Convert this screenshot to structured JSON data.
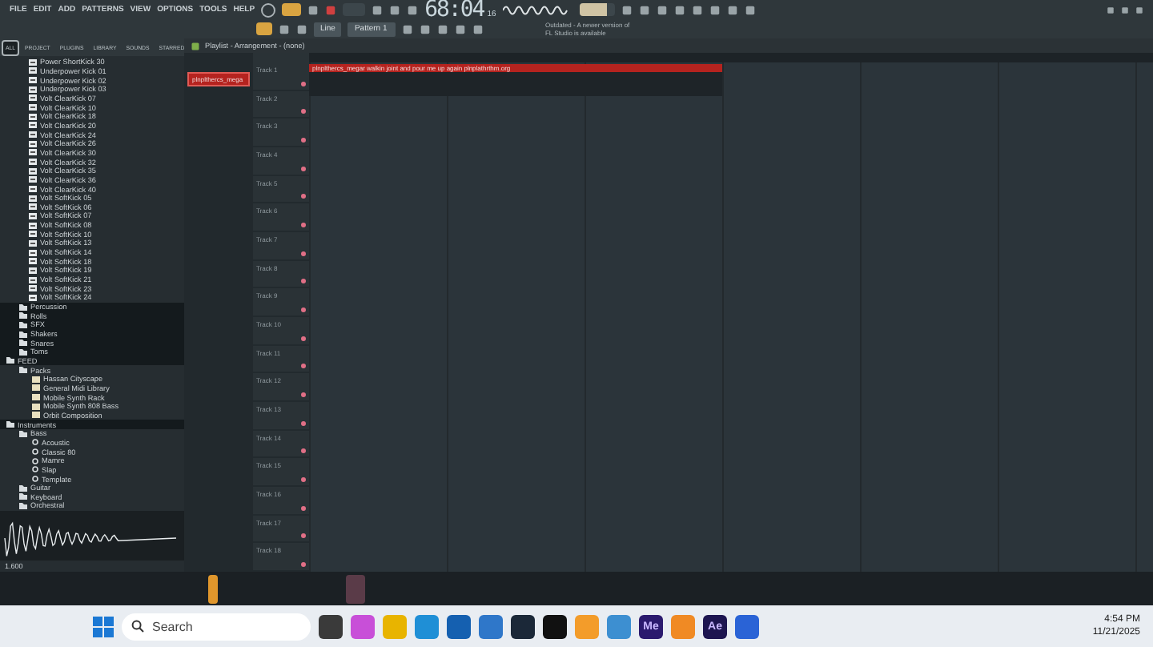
{
  "menu": [
    "FILE",
    "EDIT",
    "ADD",
    "PATTERNS",
    "VIEW",
    "OPTIONS",
    "TOOLS",
    "HELP"
  ],
  "song_time": {
    "main": "68:04",
    "sub": "16"
  },
  "pattern_mode": {
    "on": true
  },
  "master_volume": {
    "level": 0.8
  },
  "pattern": "Pattern 1",
  "snap": "Line",
  "update_hint": [
    "Outdated - A newer version of",
    "FL Studio is available"
  ],
  "browser": {
    "tabs": [
      {
        "label": "ALL",
        "selected": true
      },
      {
        "label": "PROJECT",
        "selected": false
      },
      {
        "label": "PLUGINS",
        "selected": false
      },
      {
        "label": "LIBRARY",
        "selected": false
      },
      {
        "label": "SOUNDS",
        "selected": false
      },
      {
        "label": "STARRED",
        "selected": false
      }
    ],
    "files": [
      "Power ShortKick 30",
      "Underpower Kick 01",
      "Underpower Kick 02",
      "Underpower Kick 03",
      "Volt ClearKick 07",
      "Volt ClearKick 10",
      "Volt ClearKick 18",
      "Volt ClearKick 20",
      "Volt ClearKick 24",
      "Volt ClearKick 26",
      "Volt ClearKick 30",
      "Volt ClearKick 32",
      "Volt ClearKick 35",
      "Volt ClearKick 36",
      "Volt ClearKick 40",
      "Volt SoftKick 05",
      "Volt SoftKick 06",
      "Volt SoftKick 07",
      "Volt SoftKick 08",
      "Volt SoftKick 10",
      "Volt SoftKick 13",
      "Volt SoftKick 14",
      "Volt SoftKick 18",
      "Volt SoftKick 19",
      "Volt SoftKick 21",
      "Volt SoftKick 23",
      "Volt SoftKick 24"
    ],
    "folders": [
      "Percussion",
      "Rolls",
      "SFX",
      "Shakers",
      "Snares",
      "Toms"
    ],
    "tree": [
      {
        "label": "FEED",
        "kind": "folder",
        "children": [
          {
            "label": "Packs",
            "kind": "folder",
            "children": [
              {
                "label": "Hassan Cityscape",
                "kind": "pack"
              },
              {
                "label": "General Midi Library",
                "kind": "pack"
              },
              {
                "label": "Mobile Synth Rack",
                "kind": "pack"
              },
              {
                "label": "Mobile Synth 808 Bass",
                "kind": "pack"
              },
              {
                "label": "Orbit Composition",
                "kind": "pack"
              }
            ]
          }
        ]
      },
      {
        "label": "Instruments",
        "kind": "folder",
        "children": [
          {
            "label": "Bass",
            "kind": "folder",
            "children": [
              {
                "label": "Acoustic",
                "kind": "preset"
              },
              {
                "label": "Classic 80",
                "kind": "preset"
              },
              {
                "label": "Mamre",
                "kind": "preset"
              },
              {
                "label": "Slap",
                "kind": "preset"
              },
              {
                "label": "Template",
                "kind": "preset"
              }
            ]
          },
          {
            "label": "Guitar",
            "kind": "folder"
          },
          {
            "label": "Keyboard",
            "kind": "folder"
          },
          {
            "label": "Orchestral",
            "kind": "folder"
          }
        ]
      }
    ],
    "preview_time": "1.600"
  },
  "playlist": {
    "title": "Playlist - Arrangement - (none)",
    "patterns": [
      "plnplthercs_mega"
    ],
    "clip": "plnplthercs_megar walkin joint and pour me up again plnplathrthm.org",
    "tracks": [
      "Track 1",
      "Track 2",
      "Track 3",
      "Track 4",
      "Track 5",
      "Track 6",
      "Track 7",
      "Track 8",
      "Track 9",
      "Track 10",
      "Track 11",
      "Track 12",
      "Track 13",
      "Track 14",
      "Track 15",
      "Track 16",
      "Track 17",
      "Track 18"
    ]
  },
  "taskbar": {
    "search": "Search",
    "apps": [
      {
        "kind": "glyph",
        "color": "#3a3a3a"
      },
      {
        "kind": "glyph",
        "color": "#c84fd8"
      },
      {
        "kind": "glyph",
        "color": "#e8b400"
      },
      {
        "kind": "glyph",
        "color": "#1f8fd6"
      },
      {
        "kind": "glyph",
        "color": "#1560b0"
      },
      {
        "kind": "glyph",
        "color": "#2f77c9"
      },
      {
        "kind": "glyph",
        "color": "#1b2838"
      },
      {
        "kind": "glyph",
        "color": "#111111"
      },
      {
        "kind": "glyph",
        "color": "#f39c2a"
      },
      {
        "kind": "glyph",
        "color": "#3d8fd1"
      },
      {
        "kind": "label",
        "label": "Me",
        "color": "#2b1a6e"
      },
      {
        "kind": "glyph",
        "color": "#f08a24"
      },
      {
        "kind": "label",
        "label": "Ae",
        "color": "#1d1550"
      },
      {
        "kind": "glyph",
        "color": "#2a63d6"
      }
    ],
    "time": "4:54 PM",
    "date": "11/21/2025"
  }
}
